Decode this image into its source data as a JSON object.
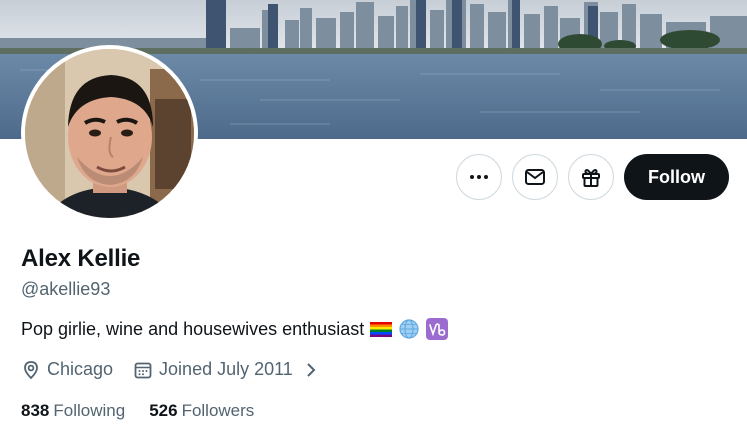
{
  "profile": {
    "name": "Alex Kellie",
    "handle": "@akellie93",
    "bio": "Pop girlie, wine and housewives enthusiast",
    "bio_emojis": [
      "rainbow-flag-icon",
      "globe-icon",
      "capricorn-icon"
    ],
    "location": "Chicago",
    "joined": "Joined July 2011",
    "following_count": "838",
    "following_label": "Following",
    "followers_count": "526",
    "followers_label": "Followers"
  },
  "actions": {
    "follow_label": "Follow",
    "icons": [
      "more-icon",
      "message-icon",
      "gift-icon"
    ]
  },
  "colors": {
    "text_primary": "#0f1419",
    "text_secondary": "#536471",
    "border": "#cfd9de",
    "follow_bg": "#0f1419"
  }
}
